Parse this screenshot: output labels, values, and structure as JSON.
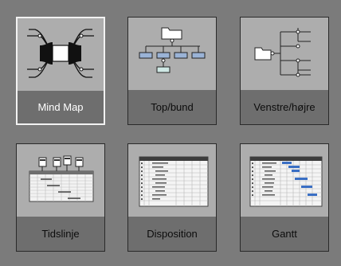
{
  "layouts": [
    {
      "label": "Mind Map",
      "icon": "mind-map-icon",
      "selected": true
    },
    {
      "label": "Top/bund",
      "icon": "top-down-tree-icon",
      "selected": false
    },
    {
      "label": "Venstre/højre",
      "icon": "left-right-tree-icon",
      "selected": false
    },
    {
      "label": "Tidslinje",
      "icon": "timeline-icon",
      "selected": false
    },
    {
      "label": "Disposition",
      "icon": "outline-table-icon",
      "selected": false
    },
    {
      "label": "Gantt",
      "icon": "gantt-chart-icon",
      "selected": false
    }
  ],
  "colors": {
    "background": "#7b7b7b",
    "tile_thumb": "#adadad",
    "tile_label_area": "#6e6e6e",
    "selected_border": "#f2f2f2",
    "node_blue": "#9ab3d6",
    "node_teal": "#cfe8e4"
  }
}
